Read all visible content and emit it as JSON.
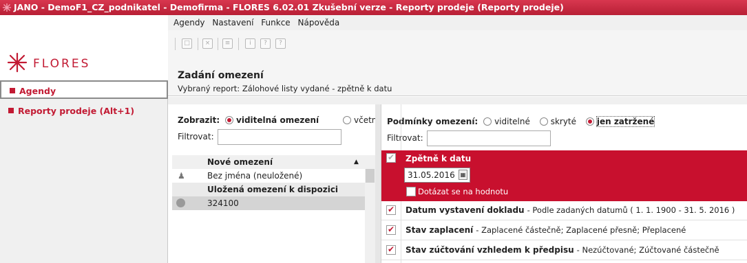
{
  "window": {
    "title": "JANO - DemoF1_CZ_podnikatel - Demofirma - FLORES 6.02.01 Zkušební verze - Reporty prodeje  (Reporty prodeje)"
  },
  "logo": {
    "text": "FLORES"
  },
  "sidebar": {
    "items": [
      {
        "label": "Agendy"
      },
      {
        "label": "Reporty prodeje (Alt+1)"
      }
    ]
  },
  "menu": {
    "items": [
      "Agendy",
      "Nastavení",
      "Funkce",
      "Nápověda"
    ]
  },
  "header": {
    "title": "Zadání omezení",
    "subtitle": "Vybraný report: Zálohové listy vydané - zpětně k datu"
  },
  "left_panel": {
    "show_label": "Zobrazit:",
    "radio_visible": "viditelná omezení",
    "radio_incl": "včetně",
    "filter_label": "Filtrovat:",
    "filter_value": "",
    "list": {
      "header": "Nové omezení",
      "rows": [
        "Bez jména (neuložené)"
      ],
      "group": "Uložená omezení k dispozici",
      "saved": [
        "324100"
      ]
    }
  },
  "right_panel": {
    "cond_label": "Podmínky omezení:",
    "radio_visible": "viditelné",
    "radio_hidden": "skryté",
    "radio_checked": "jen zatržené",
    "filter_label": "Filtrovat:",
    "filter_value": "",
    "active": {
      "title": "Zpětně k datu",
      "date": "31.05.2016",
      "ask_label": "Dotázat se na hodnotu"
    },
    "conditions": [
      {
        "name": "Datum vystavení dokladu",
        "detail": "- Podle zadaných datumů ( 1. 1. 1900 - 31. 5. 2016 )"
      },
      {
        "name": "Stav zaplacení",
        "detail": "- Zaplacené částečně; Zaplacené přesně; Přeplacené"
      },
      {
        "name": "Stav zúčtování vzhledem k předpisu",
        "detail": "- Nezúčtované; Zúčtované částečně"
      }
    ]
  },
  "colors": {
    "brand": "#c8102e",
    "title_bar": "#c21a33"
  }
}
